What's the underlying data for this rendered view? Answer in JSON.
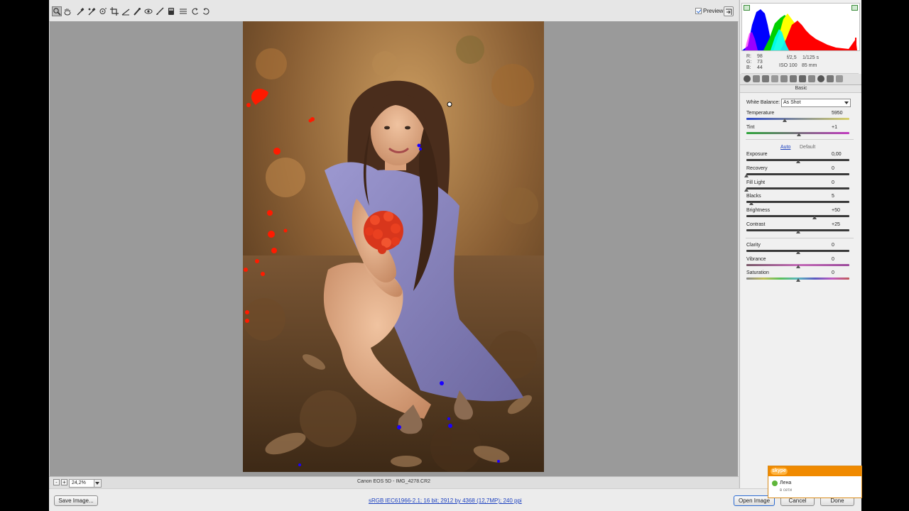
{
  "app": {
    "name": "Camera Raw"
  },
  "toolbar": {
    "tools": [
      {
        "name": "zoom-tool-icon"
      },
      {
        "name": "hand-tool-icon"
      },
      {
        "name": "white-balance-tool-icon"
      },
      {
        "name": "color-sampler-icon"
      },
      {
        "name": "target-adjustment-icon"
      },
      {
        "name": "crop-tool-icon"
      },
      {
        "name": "straighten-tool-icon"
      },
      {
        "name": "spot-removal-icon"
      },
      {
        "name": "red-eye-icon"
      },
      {
        "name": "adjustment-brush-icon"
      },
      {
        "name": "graduated-filter-icon"
      },
      {
        "name": "preferences-icon"
      },
      {
        "name": "rotate-ccw-icon"
      },
      {
        "name": "rotate-cw-icon"
      }
    ],
    "preview_label": "Preview",
    "preview_checked": true
  },
  "statusbar": {
    "zoom": "24,2%",
    "camera": "Canon EOS 5D  -  IMG_4278.CR2"
  },
  "bottombar": {
    "save_label": "Save Image...",
    "info_link": "sRGB IEC61966-2.1; 16 bit; 2912 by 4368 (12,7MP); 240 ppi",
    "open_label": "Open Image",
    "cancel_label": "Cancel",
    "done_label": "Done"
  },
  "readout": {
    "r_label": "R:",
    "r": "98",
    "g_label": "G:",
    "g": "73",
    "b_label": "B:",
    "b": "44",
    "aperture": "f/2,5",
    "shutter": "1/125 s",
    "iso": "ISO 100",
    "focal": "85 mm"
  },
  "panel": {
    "title": "Basic",
    "white_balance_label": "White Balance:",
    "white_balance_value": "As Shot",
    "auto_label": "Auto",
    "default_label": "Default",
    "sliders": [
      {
        "label": "Temperature",
        "value": "5950",
        "fraction": 0.37
      },
      {
        "label": "Tint",
        "value": "+1",
        "fraction": 0.51
      },
      {
        "label": "Exposure",
        "value": "0,00",
        "fraction": 0.5
      },
      {
        "label": "Recovery",
        "value": "0",
        "fraction": 0.0
      },
      {
        "label": "Fill Light",
        "value": "0",
        "fraction": 0.0
      },
      {
        "label": "Blacks",
        "value": "5",
        "fraction": 0.05
      },
      {
        "label": "Brightness",
        "value": "+50",
        "fraction": 0.66
      },
      {
        "label": "Contrast",
        "value": "+25",
        "fraction": 0.5
      },
      {
        "label": "Clarity",
        "value": "0",
        "fraction": 0.5
      },
      {
        "label": "Vibrance",
        "value": "0",
        "fraction": 0.5
      },
      {
        "label": "Saturation",
        "value": "0",
        "fraction": 0.5
      }
    ]
  },
  "skype": {
    "logo": "skype",
    "contact": "Лена",
    "status": "в сети"
  },
  "colors": {
    "accent": "#2a6ad1",
    "clip_red": "#ff1a00",
    "clip_blue": "#1a00ff",
    "skype_orange": "#f08a00"
  }
}
